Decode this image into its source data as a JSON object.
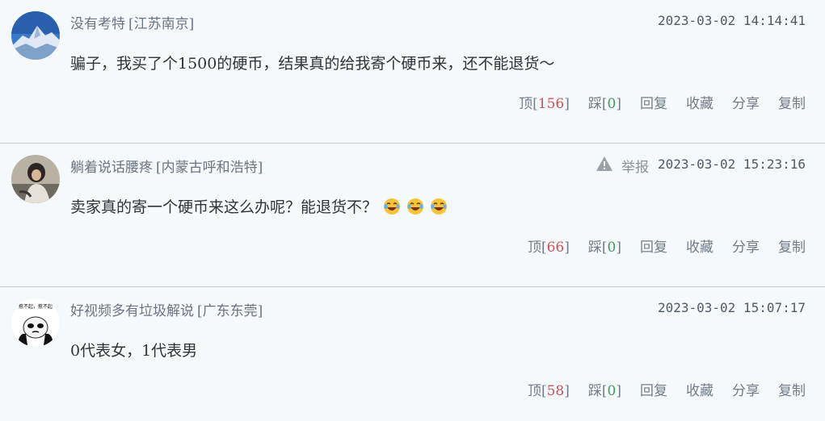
{
  "comments": [
    {
      "author": "没有考特",
      "location": "[江苏南京]",
      "time": "2023-03-02 14:14:41",
      "text": "骗子，我买了个1500的硬币，结果真的给我寄个硬币来，还不能退货～",
      "up_label": "顶",
      "up_count": "156",
      "down_label": "踩",
      "down_count": "0",
      "reply": "回复",
      "favorite": "收藏",
      "share": "分享",
      "copy": "复制",
      "avatar_icon": "mountain-avatar-icon"
    },
    {
      "author": "躺着说话腰疼",
      "location": "[内蒙古呼和浩特]",
      "report": "举报",
      "time": "2023-03-02 15:23:16",
      "text": "卖家真的寄一个硬币来这么办呢？能退货不？",
      "emoji_count_shown": 3,
      "emoji_icon": "laughing-tears-emoji",
      "up_label": "顶",
      "up_count": "66",
      "down_label": "踩",
      "down_count": "0",
      "reply": "回复",
      "favorite": "收藏",
      "share": "分享",
      "copy": "复制",
      "avatar_icon": "person-photo-avatar-icon"
    },
    {
      "author": "好视频多有垃圾解说",
      "location": "[广东东莞]",
      "time": "2023-03-02 15:07:17",
      "text": "0代表女，1代表男",
      "up_label": "顶",
      "up_count": "58",
      "down_label": "踩",
      "down_count": "0",
      "reply": "回复",
      "favorite": "收藏",
      "share": "分享",
      "copy": "复制",
      "avatar_icon": "panda-meme-avatar-icon",
      "avatar_text": "惹不起，惹不起"
    }
  ],
  "colors": {
    "background": "#f6f9fc",
    "up_count": "#d05252",
    "down_count": "#3e9b55",
    "meta_text": "#6a7483"
  }
}
